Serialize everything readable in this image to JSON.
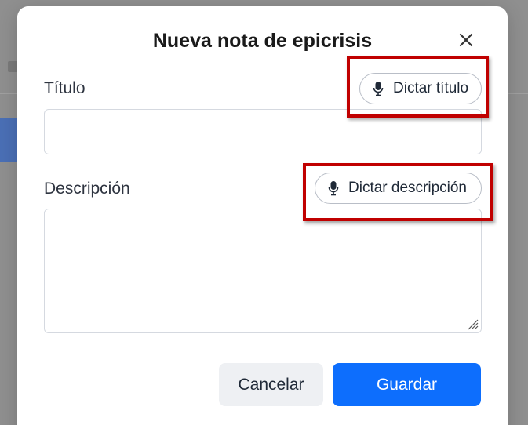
{
  "modal": {
    "title": "Nueva nota de epicrisis",
    "close_icon": "close-icon"
  },
  "fields": {
    "title": {
      "label": "Título",
      "value": "",
      "placeholder": "",
      "dictate_label": "Dictar título",
      "dictate_icon": "microphone-icon"
    },
    "description": {
      "label": "Descripción",
      "value": "",
      "placeholder": "",
      "dictate_label": "Dictar descripción",
      "dictate_icon": "microphone-icon"
    }
  },
  "actions": {
    "cancel_label": "Cancelar",
    "save_label": "Guardar"
  },
  "colors": {
    "primary": "#0d6efd",
    "highlight": "#c00000",
    "secondary_button": "#eef0f3",
    "overlay": "#8f8f8f"
  }
}
